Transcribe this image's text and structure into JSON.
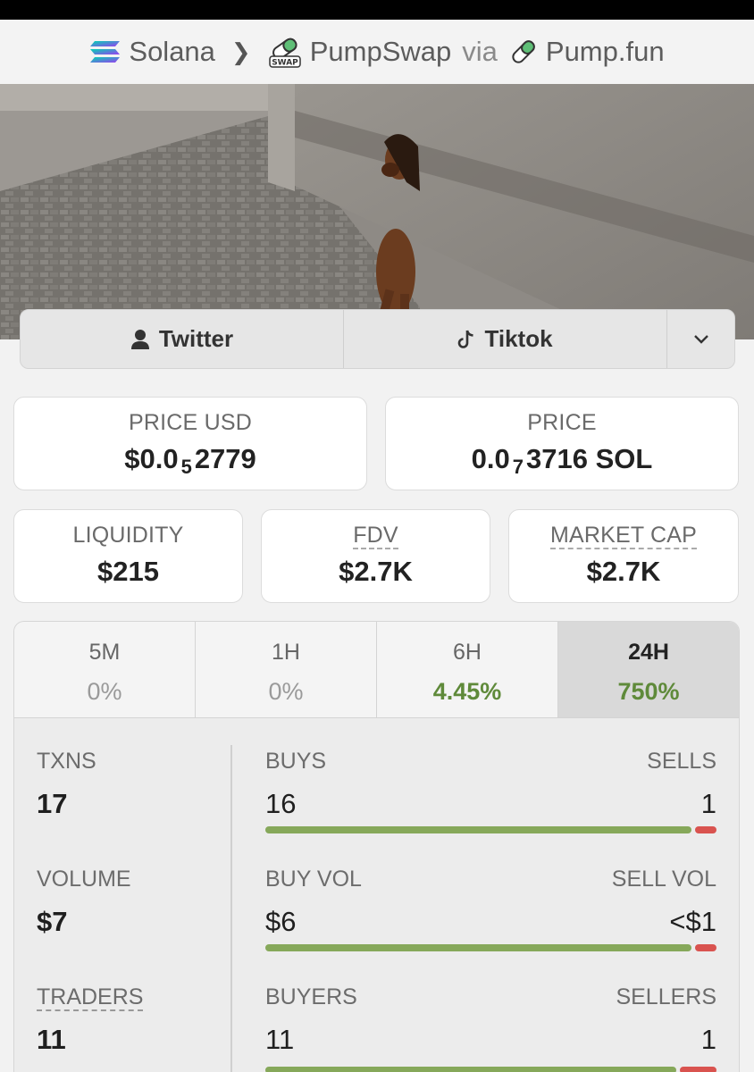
{
  "breadcrumb": {
    "chain": "Solana",
    "dex": "PumpSwap",
    "via": "via",
    "source": "Pump.fun",
    "dex_badge": "SWAP"
  },
  "banner": {
    "icon": "horse-photo-banner"
  },
  "social": {
    "twitter_label": "Twitter",
    "tiktok_label": "Tiktok"
  },
  "price": {
    "usd_label": "PRICE USD",
    "usd_prefix": "$0.0",
    "usd_zeros": "5",
    "usd_digits": "2779",
    "native_label": "PRICE",
    "native_prefix": "0.0",
    "native_zeros": "7",
    "native_digits": "3716 SOL"
  },
  "metrics": {
    "liquidity_label": "LIQUIDITY",
    "liquidity_value": "$215",
    "fdv_label": "FDV",
    "fdv_value": "$2.7K",
    "mcap_label": "MARKET CAP",
    "mcap_value": "$2.7K"
  },
  "timeframes": [
    {
      "label": "5M",
      "change": "0%"
    },
    {
      "label": "1H",
      "change": "0%"
    },
    {
      "label": "6H",
      "change": "4.45%"
    },
    {
      "label": "24H",
      "change": "750%"
    }
  ],
  "stats": {
    "txns_label": "TXNS",
    "txns_value": "17",
    "buys_label": "BUYS",
    "buys_value": "16",
    "sells_label": "SELLS",
    "sells_value": "1",
    "volume_label": "VOLUME",
    "volume_value": "$7",
    "buy_vol_label": "BUY VOL",
    "buy_vol_value": "$6",
    "sell_vol_label": "SELL VOL",
    "sell_vol_value": "<$1",
    "traders_label": "TRADERS",
    "traders_value": "11",
    "buyers_label": "BUYERS",
    "buyers_value": "11",
    "sellers_label": "SELLERS",
    "sellers_value": "1"
  },
  "colors": {
    "positive": "#5f8a3a",
    "buy_bar": "#86a85a",
    "sell_bar": "#d9534f"
  }
}
